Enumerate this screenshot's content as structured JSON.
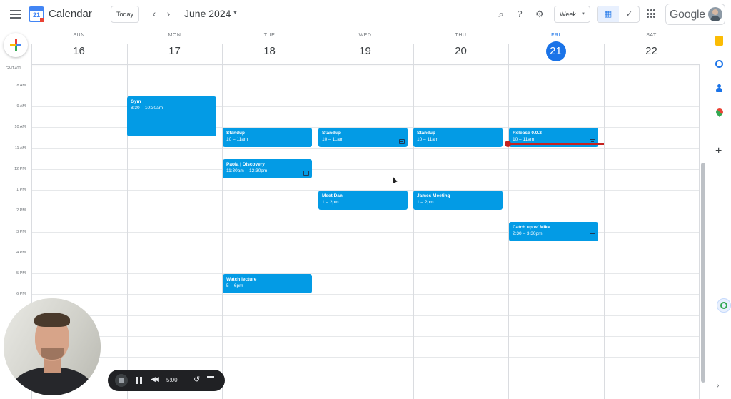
{
  "app": {
    "title": "Calendar",
    "logo_day": "21",
    "today_label": "Today",
    "prev_icon": "chevron-left-icon",
    "next_icon": "chevron-right-icon",
    "month": "June 2024",
    "view": "Week",
    "brand": "Google"
  },
  "toolbar_icons": [
    "search-icon",
    "help-icon",
    "settings-icon",
    "calendar-view-icon",
    "tasks-view-icon",
    "apps-grid-icon"
  ],
  "days": [
    {
      "dow": "SUN",
      "date": "16",
      "today": false
    },
    {
      "dow": "MON",
      "date": "17",
      "today": false
    },
    {
      "dow": "TUE",
      "date": "18",
      "today": false
    },
    {
      "dow": "WED",
      "date": "19",
      "today": false
    },
    {
      "dow": "THU",
      "date": "20",
      "today": false
    },
    {
      "dow": "FRI",
      "date": "21",
      "today": true
    },
    {
      "dow": "SAT",
      "date": "22",
      "today": false
    }
  ],
  "timezone": "GMT+01",
  "hours": [
    "8 AM",
    "9 AM",
    "10 AM",
    "11 AM",
    "12 PM",
    "1 PM",
    "2 PM",
    "3 PM",
    "4 PM",
    "5 PM",
    "6 PM"
  ],
  "events": [
    {
      "title": "Gym",
      "time": "8:30 – 10:30am",
      "day": 1,
      "has_note": false
    },
    {
      "title": "Standup",
      "time": "10 – 11am",
      "day": 2,
      "has_note": false
    },
    {
      "title": "Standup",
      "time": "10 – 11am",
      "day": 3,
      "has_note": true
    },
    {
      "title": "Standup",
      "time": "10 – 11am",
      "day": 4,
      "has_note": false
    },
    {
      "title": "Release 0.0.2",
      "time": "10 – 11am",
      "day": 5,
      "has_note": true
    },
    {
      "title": "Paola | Discovery",
      "time": "11:30am – 12:30pm",
      "day": 2,
      "has_note": true
    },
    {
      "title": "Meet Dan",
      "time": "1 – 2pm",
      "day": 3,
      "has_note": false
    },
    {
      "title": "James Meeting",
      "time": "1 – 2pm",
      "day": 4,
      "has_note": false
    },
    {
      "title": "Catch up w/ Mike",
      "time": "2:30 – 3:30pm",
      "day": 5,
      "has_note": true
    },
    {
      "title": "Watch lecture",
      "time": "5 – 6pm",
      "day": 2,
      "has_note": false
    }
  ],
  "colors": {
    "event": "#039be5",
    "today": "#1a73e8",
    "now_line": "#c5221f"
  },
  "side_apps": [
    "keep-icon",
    "tasks-icon",
    "contacts-icon",
    "maps-icon",
    "add-icon"
  ],
  "recorder": {
    "time": "5:00"
  }
}
